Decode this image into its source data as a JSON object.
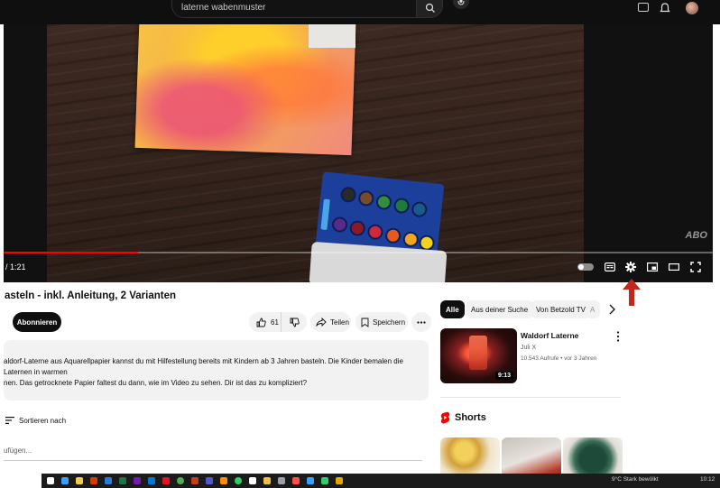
{
  "search": {
    "query": "laterne wabenmuster"
  },
  "player": {
    "time": "/ 1:21",
    "progress_fraction": 0.19,
    "watermark": "ABO",
    "controls": [
      "autoplay-toggle",
      "subtitles-icon",
      "settings-icon",
      "miniplayer-icon",
      "theater-mode-icon",
      "fullscreen-icon"
    ]
  },
  "video": {
    "title": "asteln - inkl. Anleitung, 2 Varianten",
    "subscribe_label": "Abonnieren",
    "likes": "61",
    "share_label": "Teilen",
    "save_label": "Speichern",
    "description_line1": "aldorf-Laterne aus Aquarellpapier kannst du mit Hilfestellung bereits mit Kindern ab 3 Jahren basteln. Die Kinder bemalen die Laternen in warmen",
    "description_line2": "nen. Das getrocknete Papier faltest du dann, wie im Video zu sehen. Dir ist das zu kompliziert?"
  },
  "comments": {
    "sort_label": "Sortieren nach",
    "input_placeholder": "ufügen..."
  },
  "sidebar": {
    "chips": [
      "Alle",
      "Aus deiner Suche",
      "Von Betzold TV",
      "A"
    ],
    "recommendation": {
      "title": "Waldorf Laterne",
      "channel": "Juli X",
      "meta": "10.543 Aufrufe • vor 3 Jahren",
      "duration": "9:13"
    },
    "shorts_label": "Shorts"
  },
  "taskbar": {
    "weather": "9°C  Stark bewölkt",
    "clock": "10:12"
  },
  "colors": {
    "accent_red": "#ff0000",
    "annotation_arrow": "#c0281c",
    "player_bg": "#111111",
    "subscribe_bg": "#0f0f0f"
  }
}
